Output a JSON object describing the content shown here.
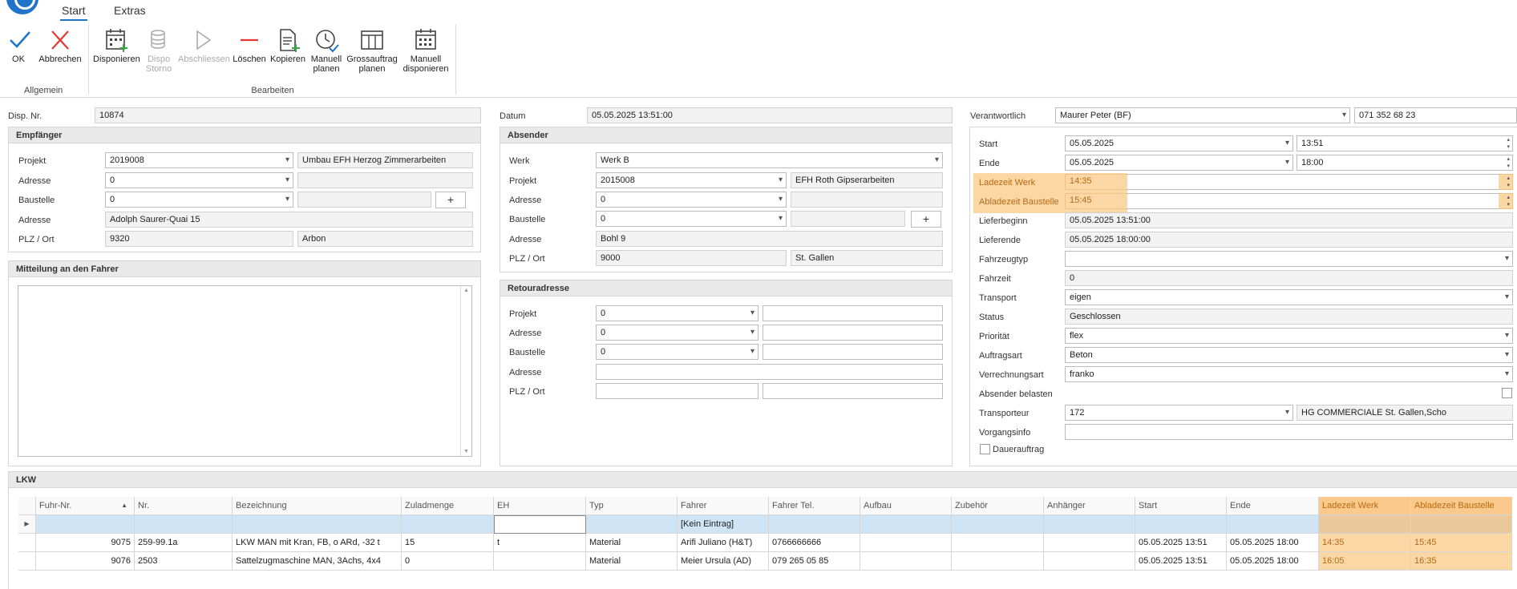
{
  "ribbon": {
    "tabs": [
      {
        "label": "Start"
      },
      {
        "label": "Extras"
      }
    ],
    "groups": {
      "allgemein": "Allgemein",
      "bearbeiten": "Bearbeiten"
    },
    "buttons": {
      "ok": "OK",
      "abbrechen": "Abbrechen",
      "disponieren": "Disponieren",
      "dispo_storno_1": "Dispo",
      "dispo_storno_2": "Storno",
      "abschliessen": "Abschliessen",
      "loeschen": "Löschen",
      "kopieren": "Kopieren",
      "manuell_planen_1": "Manuell",
      "manuell_planen_2": "planen",
      "gross_1": "Grossauftrag",
      "gross_2": "planen",
      "manuell_disp_1": "Manuell",
      "manuell_disp_2": "disponieren"
    },
    "colors": {
      "accent": "#1f73c9",
      "cancel": "#e53935"
    }
  },
  "header": {
    "disp_nr_label": "Disp. Nr.",
    "disp_nr": "10874",
    "datum_label": "Datum",
    "datum": "05.05.2025 13:51:00",
    "verantwortlich_label": "Verantwortlich",
    "verantwortlich": "Maurer Peter (BF)",
    "telefon": "071 352 68 23"
  },
  "empfaenger": {
    "title": "Empfänger",
    "projekt_label": "Projekt",
    "projekt": "2019008",
    "projekt_name": "Umbau EFH Herzog Zimmerarbeiten",
    "adresse_label": "Adresse",
    "adresse": "0",
    "baustelle_label": "Baustelle",
    "baustelle": "0",
    "adresse2_label": "Adresse",
    "adresse2": "Adolph Saurer-Quai 15",
    "plz_label": "PLZ / Ort",
    "plz": "9320",
    "ort": "Arbon",
    "plus": "+"
  },
  "mitteilung": {
    "title": "Mitteilung an den Fahrer"
  },
  "absender": {
    "title": "Absender",
    "werk_label": "Werk",
    "werk": "Werk B",
    "projekt_label": "Projekt",
    "projekt": "2015008",
    "projekt_name": "EFH Roth Gipserarbeiten",
    "adresse_label": "Adresse",
    "adresse": "0",
    "baustelle_label": "Baustelle",
    "baustelle": "0",
    "adresse2_label": "Adresse",
    "adresse2": "Bohl 9",
    "plz_label": "PLZ / Ort",
    "plz": "9000",
    "ort": "St. Gallen",
    "plus": "+"
  },
  "retour": {
    "title": "Retouradresse",
    "projekt_label": "Projekt",
    "projekt": "0",
    "adresse_label": "Adresse",
    "adresse": "0",
    "baustelle_label": "Baustelle",
    "baustelle": "0",
    "adresse2_label": "Adresse",
    "plz_label": "PLZ / Ort"
  },
  "right": {
    "start_label": "Start",
    "start_date": "05.05.2025",
    "start_time": "13:51",
    "ende_label": "Ende",
    "ende_date": "05.05.2025",
    "ende_time": "18:00",
    "ladezeit_label": "Ladezeit Werk",
    "ladezeit": "14:35",
    "abladezeit_label": "Abladezeit Baustelle",
    "abladezeit": "15:45",
    "lieferbeginn_label": "Lieferbeginn",
    "lieferbeginn": "05.05.2025 13:51:00",
    "lieferende_label": "Lieferende",
    "lieferende": "05.05.2025 18:00:00",
    "fahrzeugtyp_label": "Fahrzeugtyp",
    "fahrzeit_label": "Fahrzeit",
    "fahrzeit": "0",
    "transport_label": "Transport",
    "transport": "eigen",
    "status_label": "Status",
    "status": "Geschlossen",
    "prioritaet_label": "Priorität",
    "prioritaet": "flex",
    "auftragsart_label": "Auftragsart",
    "auftragsart": "Beton",
    "verrechnungsart_label": "Verrechnungsart",
    "verrechnungsart": "franko",
    "absender_belasten_label": "Absender belasten",
    "transporteur_label": "Transporteur",
    "transporteur": "172",
    "transporteur_name": "HG COMMERCIALE St. Gallen,Scho",
    "vorgangsinfo_label": "Vorgangsinfo",
    "dauerauftrag_label": "Dauerauftrag"
  },
  "lkw": {
    "title": "LKW",
    "columns": [
      "Fuhr-Nr.",
      "Nr.",
      "Bezeichnung",
      "Zuladmenge",
      "EH",
      "Typ",
      "Fahrer",
      "Fahrer Tel.",
      "Aufbau",
      "Zubehör",
      "Anhänger",
      "Start",
      "Ende",
      "Ladezeit Werk",
      "Abladezeit Baustelle"
    ],
    "new_row_text": "[Kein Eintrag]",
    "rows": [
      [
        "9075",
        "259-99.1a",
        "LKW MAN mit Kran, FB, o ARd, -32 t",
        "15",
        "t",
        "Material",
        "Arifi Juliano (H&T)",
        "0766666666",
        "",
        "",
        "",
        "05.05.2025 13:51",
        "05.05.2025 18:00",
        "14:35",
        "15:45"
      ],
      [
        "9076",
        "2503",
        "Sattelzugmaschine MAN, 3Achs, 4x4",
        "0",
        "",
        "Material",
        "Meier Ursula (AD)",
        "079 265 05 85",
        "",
        "",
        "",
        "05.05.2025 13:51",
        "05.05.2025 18:00",
        "16:05",
        "16:35"
      ]
    ]
  }
}
